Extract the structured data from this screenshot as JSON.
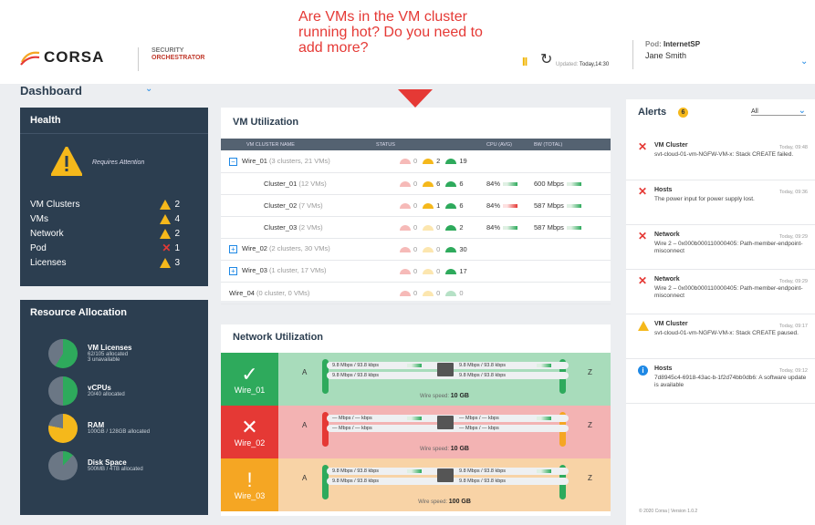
{
  "header": {
    "logo_text": "CORSA",
    "product_line1": "SECURITY",
    "product_line2": "ORCHESTRATOR",
    "callout": "Are VMs in the VM cluster running hot? Do you need to add more?",
    "updated_label": "Updated:",
    "updated_value": "Today,14:30",
    "pod_label": "Pod:",
    "pod_value": "InternetSP",
    "user": "Jane Smith",
    "page_title": "Dashboard"
  },
  "health": {
    "title": "Health",
    "status": "Requires Attention",
    "rows": [
      {
        "label": "VM Clusters",
        "value": "2",
        "icon": "warning-icon"
      },
      {
        "label": "VMs",
        "value": "4",
        "icon": "warning-icon"
      },
      {
        "label": "Network",
        "value": "2",
        "icon": "warning-icon"
      },
      {
        "label": "Pod",
        "value": "1",
        "icon": "error-x-icon"
      },
      {
        "label": "Licenses",
        "value": "3",
        "icon": "warning-icon"
      }
    ]
  },
  "resources": {
    "title": "Resource Allocation",
    "items": [
      {
        "name": "VM Licenses",
        "line1": "62/105 allocated",
        "line2": "3 unavailable",
        "fraction": 0.59,
        "color": "#2eaa5c"
      },
      {
        "name": "vCPUs",
        "line1": "20/40 allocated",
        "line2": "",
        "fraction": 0.5,
        "color": "#2eaa5c"
      },
      {
        "name": "RAM",
        "line1": "100GB / 128GB allocated",
        "line2": "",
        "fraction": 0.78,
        "color": "#f5b81b"
      },
      {
        "name": "Disk Space",
        "line1": "500MB / 4TB allocated",
        "line2": "",
        "fraction": 0.12,
        "color": "#2eaa5c"
      }
    ]
  },
  "vm_util": {
    "title": "VM Utilization",
    "columns": [
      "VM CLUSTER NAME",
      "STATUS",
      "CPU (AVG)",
      "BW (TOTAL)"
    ],
    "rows": [
      {
        "name": "Wire_01",
        "detail": "(3 clusters, 21 VMs)",
        "r": "0",
        "y": "2",
        "g": "19",
        "cpu": "",
        "bw": "",
        "toggle": "−",
        "level": 0
      },
      {
        "name": "Cluster_01",
        "detail": "(12 VMs)",
        "r": "0",
        "y": "6",
        "g": "6",
        "cpu": "84%",
        "bw": "600 Mbps",
        "toggle": "",
        "level": 1
      },
      {
        "name": "Cluster_02",
        "detail": "(7 VMs)",
        "r": "0",
        "y": "1",
        "g": "6",
        "cpu": "84%",
        "bw": "587 Mbps",
        "toggle": "",
        "level": 1
      },
      {
        "name": "Cluster_03",
        "detail": "(2 VMs)",
        "r": "0",
        "y": "0",
        "g": "2",
        "cpu": "84%",
        "bw": "587 Mbps",
        "toggle": "",
        "level": 1
      },
      {
        "name": "Wire_02",
        "detail": "(2 clusters, 30 VMs)",
        "r": "0",
        "y": "0",
        "g": "30",
        "cpu": "",
        "bw": "",
        "toggle": "+",
        "level": 0
      },
      {
        "name": "Wire_03",
        "detail": "(1 cluster, 17 VMs)",
        "r": "0",
        "y": "0",
        "g": "17",
        "cpu": "",
        "bw": "",
        "toggle": "+",
        "level": 0
      },
      {
        "name": "Wire_04",
        "detail": "(0 cluster, 0 VMs)",
        "r": "0",
        "y": "0",
        "g": "0",
        "cpu": "",
        "bw": "",
        "toggle": "",
        "level": 0
      }
    ]
  },
  "network": {
    "title": "Network Utilization",
    "end_a": "A",
    "end_z": "Z",
    "speed_label": "Wire speed:",
    "wires": [
      {
        "name": "Wire_01",
        "state": "ok",
        "icon": "✓",
        "left_bg": "#2eaa5c",
        "bg": "#a8dcbb",
        "left1": "9.8 Mbps / 93.8 kbps",
        "left2": "9.8 Mbps / 93.8 kbps",
        "right1": "9.8 Mbps / 93.8 kbps",
        "right2": "9.8 Mbps / 93.8 kbps",
        "speed": "10 GB"
      },
      {
        "name": "Wire_02",
        "state": "error",
        "icon": "✕",
        "left_bg": "#e53935",
        "bg": "#f3b3b3",
        "left1": "— Mbps / — kbps",
        "left2": "— Mbps / — kbps",
        "right1": "— Mbps / — kbps",
        "right2": "— Mbps / — kbps",
        "speed": "10 GB"
      },
      {
        "name": "Wire_03",
        "state": "warning",
        "icon": "!",
        "left_bg": "#f5a623",
        "bg": "#f8d3a6",
        "left1": "9.8 Mbps / 93.8 kbps",
        "left2": "9.8 Mbps / 93.8 kbps",
        "right1": "9.8 Mbps / 93.8 kbps",
        "right2": "9.8 Mbps / 93.8 kbps",
        "speed": "100 GB"
      }
    ]
  },
  "alerts": {
    "title": "Alerts",
    "count": "6",
    "filter": "All",
    "items": [
      {
        "type": "error",
        "title": "VM Cluster",
        "time": "Today, 09:48",
        "desc": "svt-cloud-01-vm-NGFW-VM-x: Stack CREATE failed."
      },
      {
        "type": "error",
        "title": "Hosts",
        "time": "Today, 09:36",
        "desc": "The power input for power supply lost."
      },
      {
        "type": "error",
        "title": "Network",
        "time": "Today, 09:29",
        "desc": "Wire 2 – 0x000b000110000405: Path-member-endpoint-misconnect"
      },
      {
        "type": "error",
        "title": "Network",
        "time": "Today, 09:29",
        "desc": "Wire 2 – 0x000b000110000405: Path-member-endpoint-misconnect"
      },
      {
        "type": "warning",
        "title": "VM Cluster",
        "time": "Today, 09:17",
        "desc": "svt-cloud-01-vm-NGFW-VM-x: Stack CREATE paused."
      },
      {
        "type": "info",
        "title": "Hosts",
        "time": "Today, 09:12",
        "desc": "7d8945c4-6918-43ac-b-1f2d74bb0db6: A software update is available"
      }
    ],
    "footer": "© 2020 Corsa   |   Version 1.0.2"
  }
}
